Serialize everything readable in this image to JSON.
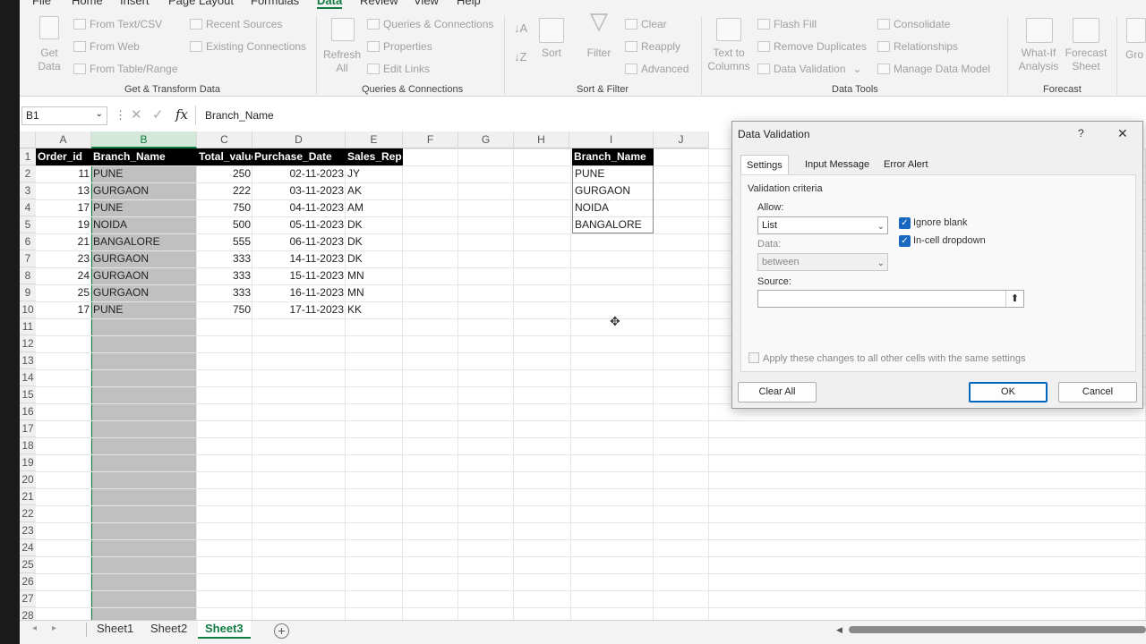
{
  "menu": {
    "file": "File",
    "home": "Home",
    "insert": "Insert",
    "page_layout": "Page Layout",
    "formulas": "Formulas",
    "data": "Data",
    "review": "Review",
    "view": "View",
    "help": "Help"
  },
  "ribbon": {
    "get_data": "Get Data",
    "from_text": "From Text/CSV",
    "from_web": "From Web",
    "from_table": "From Table/Range",
    "recent_sources": "Recent Sources",
    "existing_connections": "Existing Connections",
    "group_get": "Get & Transform Data",
    "refresh_all": "Refresh All",
    "queries_connections": "Queries & Connections",
    "properties": "Properties",
    "edit_links": "Edit Links",
    "group_queries": "Queries & Connections",
    "sort": "Sort",
    "filter": "Filter",
    "clear": "Clear",
    "reapply": "Reapply",
    "advanced": "Advanced",
    "group_sort": "Sort & Filter",
    "text_to_columns": "Text to Columns",
    "flash_fill": "Flash Fill",
    "remove_duplicates": "Remove Duplicates",
    "data_validation": "Data Validation",
    "consolidate": "Consolidate",
    "relationships": "Relationships",
    "manage_data_model": "Manage Data Model",
    "group_tools": "Data Tools",
    "what_if": "What-If Analysis",
    "forecast_sheet": "Forecast Sheet",
    "group_forecast": "Forecast",
    "group_cut": "Gro"
  },
  "formula_bar": {
    "name_box": "B1",
    "formula": "Branch_Name",
    "fx": "fx"
  },
  "columns": [
    "A",
    "B",
    "C",
    "D",
    "E",
    "F",
    "G",
    "H",
    "I",
    "J"
  ],
  "rows": [
    "1",
    "2",
    "3",
    "4",
    "5",
    "6",
    "7",
    "8",
    "9",
    "10",
    "11",
    "12",
    "13",
    "14",
    "15",
    "16",
    "17",
    "18",
    "19",
    "20",
    "21",
    "22",
    "23",
    "24",
    "25",
    "26",
    "27",
    "28"
  ],
  "table": {
    "headers": [
      "Order_id",
      "Branch_Name",
      "Total_value",
      "Purchase_Date",
      "Sales_Rep"
    ],
    "rows": [
      [
        "11",
        "PUNE",
        "250",
        "02-11-2023",
        "JY"
      ],
      [
        "13",
        "GURGAON",
        "222",
        "03-11-2023",
        "AK"
      ],
      [
        "17",
        "PUNE",
        "750",
        "04-11-2023",
        "AM"
      ],
      [
        "19",
        "NOIDA",
        "500",
        "05-11-2023",
        "DK"
      ],
      [
        "21",
        "BANGALORE",
        "555",
        "06-11-2023",
        "DK"
      ],
      [
        "23",
        "GURGAON",
        "333",
        "14-11-2023",
        "DK"
      ],
      [
        "24",
        "GURGAON",
        "333",
        "15-11-2023",
        "MN"
      ],
      [
        "25",
        "GURGAON",
        "333",
        "16-11-2023",
        "MN"
      ],
      [
        "17",
        "PUNE",
        "750",
        "17-11-2023",
        "KK"
      ]
    ]
  },
  "branch_list": {
    "header": "Branch_Name",
    "items": [
      "PUNE",
      "GURGAON",
      "NOIDA",
      "BANGALORE"
    ]
  },
  "sheets": [
    "Sheet1",
    "Sheet2",
    "Sheet3"
  ],
  "dialog": {
    "title": "Data Validation",
    "help": "?",
    "close": "✕",
    "tabs": [
      "Settings",
      "Input Message",
      "Error Alert"
    ],
    "criteria": "Validation criteria",
    "allow_label": "Allow:",
    "allow_value": "List",
    "data_label": "Data:",
    "data_value": "between",
    "source_label": "Source:",
    "source_value": "",
    "ignore_blank": "Ignore blank",
    "in_cell_dropdown": "In-cell dropdown",
    "apply_all": "Apply these changes to all other cells with the same settings",
    "clear_all": "Clear All",
    "ok": "OK",
    "cancel": "Cancel"
  },
  "colors": {
    "accent": "#107c41",
    "selection": "#c0c0c0",
    "header_bg": "#000000",
    "check": "#1867c0"
  }
}
